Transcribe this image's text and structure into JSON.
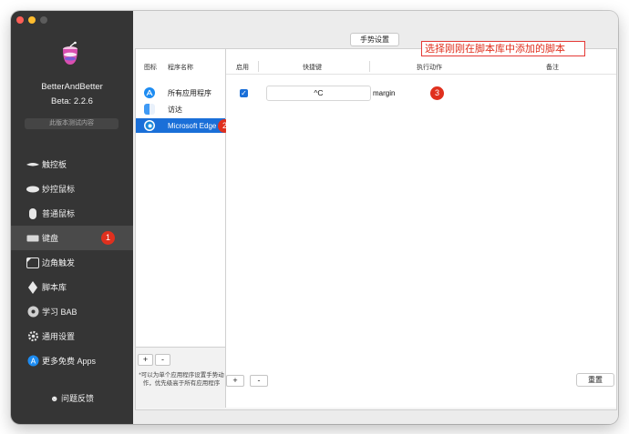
{
  "app": {
    "name": "BetterAndBetter",
    "version": "Beta: 2.2.6",
    "beta_button": "此版本测试内容",
    "feedback": "问题反馈"
  },
  "sidebar": {
    "items": [
      {
        "label": "触控板",
        "icon": "trackpad-icon"
      },
      {
        "label": "妙控鼠标",
        "icon": "magic-mouse-icon"
      },
      {
        "label": "普通鼠标",
        "icon": "mouse-icon"
      },
      {
        "label": "键盘",
        "icon": "keyboard-icon",
        "active": true,
        "badge": "1"
      },
      {
        "label": "边角触发",
        "icon": "corner-trigger-icon"
      },
      {
        "label": "脚本库",
        "icon": "script-library-icon"
      },
      {
        "label": "学习 BAB",
        "icon": "learn-icon"
      },
      {
        "label": "通用设置",
        "icon": "gear-icon"
      },
      {
        "label": "更多免费 Apps",
        "icon": "app-store-icon"
      }
    ]
  },
  "main": {
    "tab": "手势设置",
    "applist": {
      "header_icon": "图标",
      "header_name": "程序名称",
      "rows": [
        {
          "label": "所有应用程序",
          "icon": "app-store-icon"
        },
        {
          "label": "访达",
          "icon": "finder-icon"
        },
        {
          "label": "Microsoft Edge",
          "icon": "edge-icon",
          "selected": true,
          "badge": "2"
        }
      ],
      "add": "+",
      "remove": "-",
      "note": "*可以为单个应用程序设置手势动作，优先级高于所有应用程序"
    },
    "table": {
      "headers": {
        "enabled": "启用",
        "shortcut": "快捷键",
        "action": "执行动作",
        "notes": "备注"
      },
      "rows": [
        {
          "enabled": true,
          "shortcut": "^C",
          "action": "margin",
          "badge": "3"
        }
      ],
      "add": "+",
      "remove": "-",
      "reset": "重置"
    },
    "annotation": "选择刚刚在脚本库中添加的脚本"
  },
  "colors": {
    "sidebar_bg": "#353535",
    "selection": "#1a6fd8",
    "badge": "#e0301e"
  }
}
